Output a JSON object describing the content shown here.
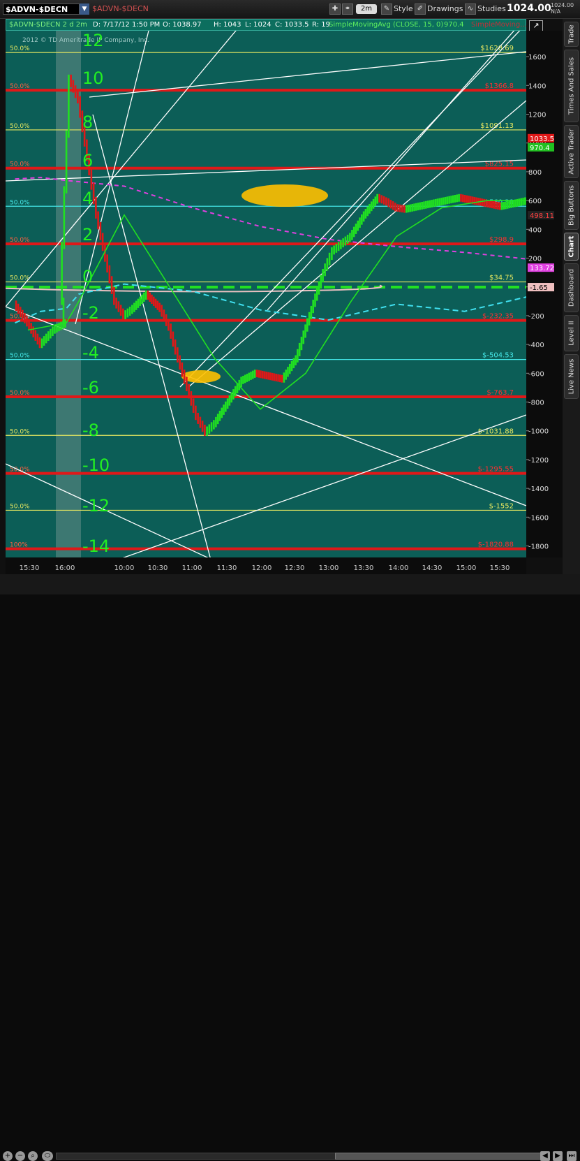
{
  "topbar": {
    "symbol": "$ADVN-$DECN",
    "symbol_echo": "$ADVN-$DECN",
    "aggregation": "2m",
    "style_label": "Style",
    "drawings_label": "Drawings",
    "studies_label": "Studies",
    "last_price": "1024.00",
    "small_info": [
      "1024.00",
      "N/A"
    ]
  },
  "infobar": {
    "symbol_period": "$ADVN-$DECN 2 d 2m",
    "date": "D: 7/17/12 1:50 PM",
    "open": "O: 1038.97",
    "high": "H: 1043",
    "low": "L: 1024",
    "close": "C: 1033.5",
    "range": "R: 19",
    "study": "SimpleMovingAvg (CLOSE, 15, 0)",
    "study_value": "970.4",
    "study2": "SimpleMoving..."
  },
  "copyright": "2012 © TD Ameritrade IP Company, Inc.",
  "side_tabs": [
    "Trade",
    "Times And Sales",
    "Active Trader",
    "Big Buttons",
    "Chart",
    "Dashboard",
    "Level II",
    "Live News"
  ],
  "active_tab": "Chart",
  "colors": {
    "background": "#0c5e57",
    "price_up": "#21e021",
    "price_down": "#e01818",
    "fib_red": "#e01818",
    "fib_cyan": "#44e6e6",
    "fib_yellow": "#e8e860",
    "sma_magenta": "#e040e0",
    "sma_cyan": "#40e0f0",
    "zero_green": "#22e022",
    "ellipse": "#ffc000"
  },
  "chart_data": {
    "type": "line",
    "title": "",
    "xlabel": "",
    "ylabel": "",
    "ylim": [
      -1880,
      1780
    ],
    "x_ticks": [
      "15:30",
      "16:00",
      "10:00",
      "10:30",
      "11:00",
      "11:30",
      "12:00",
      "12:30",
      "13:00",
      "13:30",
      "14:00",
      "14:30",
      "15:00",
      "15:30"
    ],
    "y_ticks": [
      1600,
      1400,
      1200,
      1000,
      800,
      600,
      400,
      200,
      0,
      -200,
      -400,
      -600,
      -800,
      -1000,
      -1200,
      -1400,
      -1600,
      -1800
    ],
    "fib_levels": [
      {
        "value": 1628.69,
        "label": "$1628.69",
        "color": "#e8e860",
        "pct": "50.0%"
      },
      {
        "value": 1366.8,
        "label": "$1366.8",
        "color": "#e01818",
        "pct": "50.0%"
      },
      {
        "value": 1091.13,
        "label": "$1091.13",
        "color": "#e8e860",
        "pct": "50.0%"
      },
      {
        "value": 825.15,
        "label": "$825.15",
        "color": "#e01818",
        "pct": "50.0%"
      },
      {
        "value": 560.38,
        "label": "$560.38",
        "color": "#44e6e6",
        "pct": "50.0%"
      },
      {
        "value": 298.9,
        "label": "$298.9",
        "color": "#e01818",
        "pct": "50.0%"
      },
      {
        "value": 34.75,
        "label": "$34.75",
        "color": "#e8e860",
        "pct": "50.0%"
      },
      {
        "value": -232.35,
        "label": "$-232.35",
        "color": "#e01818",
        "pct": "50.0%"
      },
      {
        "value": -504.53,
        "label": "$-504.53",
        "color": "#44e6e6",
        "pct": "50.0%"
      },
      {
        "value": -763.7,
        "label": "$-763.7",
        "color": "#e01818",
        "pct": "50.0%"
      },
      {
        "value": -1031.88,
        "label": "$-1031.88",
        "color": "#e8e860",
        "pct": "50.0%"
      },
      {
        "value": -1295.55,
        "label": "$-1295.55",
        "color": "#e01818",
        "pct": "50.0%"
      },
      {
        "value": -1552,
        "label": "$-1552",
        "color": "#e8e860",
        "pct": "50.0%"
      },
      {
        "value": -1820,
        "label": "$-1820.88",
        "color": "#e01818",
        "pct": "100%"
      }
    ],
    "markers": [
      {
        "value": 1033.5,
        "label": "1033.5",
        "bg": "#e01818",
        "fg": "#ffffff"
      },
      {
        "value": 970.4,
        "label": "970.4",
        "bg": "#21c021",
        "fg": "#ffffff"
      },
      {
        "value": 498.11,
        "label": "498.11",
        "bg": "#222222",
        "fg": "#ff4040"
      },
      {
        "value": 133.72,
        "label": "133.72",
        "bg": "#e040e0",
        "fg": "#ffffff"
      },
      {
        "value": -1.65,
        "label": "-1.65",
        "bg": "#f0c0c0",
        "fg": "#000000"
      }
    ],
    "secondary_scale": [
      "12",
      "10",
      "8",
      "6",
      "4",
      "2",
      "0",
      "-2",
      "-4",
      "-6",
      "-8",
      "-10",
      "-12",
      "-14"
    ],
    "series": [
      {
        "kind": "price",
        "x": [
          "15:20",
          "15:30",
          "15:40",
          "15:50",
          "16:00",
          "09:32",
          "09:36",
          "09:40",
          "09:44",
          "09:48",
          "09:52",
          "09:56",
          "10:00",
          "10:04",
          "10:10",
          "10:16",
          "10:20",
          "10:24",
          "10:28",
          "10:32",
          "10:36",
          "10:40",
          "10:46",
          "10:52",
          "10:58",
          "11:04",
          "11:10",
          "11:16",
          "11:22",
          "11:28",
          "11:32",
          "11:36",
          "11:40",
          "11:46",
          "11:52",
          "11:56",
          "12:00",
          "12:04",
          "12:10",
          "12:16",
          "12:22",
          "12:28",
          "12:34",
          "12:40",
          "12:46",
          "12:52",
          "12:58",
          "13:04",
          "13:10",
          "13:16",
          "13:22",
          "13:28",
          "13:34",
          "13:40",
          "13:46",
          "13:50"
        ],
        "values": [
          -120,
          -250,
          -400,
          -300,
          -250,
          -100,
          1450,
          1300,
          900,
          500,
          200,
          -100,
          -200,
          -150,
          -50,
          -150,
          -280,
          -500,
          -700,
          -900,
          -1010,
          -950,
          -800,
          -650,
          -600,
          -620,
          -640,
          -500,
          -200,
          100,
          250,
          300,
          350,
          500,
          620,
          590,
          550,
          540,
          560,
          580,
          600,
          620,
          600,
          580,
          560,
          580,
          600,
          640,
          700,
          800,
          900,
          960,
          980,
          1020,
          1030,
          1033.5
        ]
      },
      {
        "kind": "sma15",
        "color": "#21e021",
        "x": [
          "15:30",
          "16:00",
          "09:40",
          "10:00",
          "10:20",
          "10:40",
          "11:00",
          "11:20",
          "11:40",
          "12:00",
          "12:20",
          "12:40",
          "13:00",
          "13:20",
          "13:40",
          "13:50"
        ],
        "values": [
          -300,
          -250,
          -100,
          500,
          0,
          -500,
          -850,
          -600,
          -100,
          350,
          550,
          600,
          600,
          700,
          850,
          970
        ]
      },
      {
        "kind": "sma_magenta",
        "color": "#e040e0",
        "x": [
          "15:20",
          "15:40",
          "16:00",
          "10:00",
          "10:30",
          "11:00",
          "11:30",
          "12:00",
          "12:30",
          "13:00",
          "13:30",
          "13:50"
        ],
        "values": [
          750,
          760,
          740,
          700,
          550,
          420,
          330,
          280,
          240,
          190,
          150,
          133.72
        ]
      },
      {
        "kind": "sma_cyan",
        "color": "#40e0f0",
        "x": [
          "15:20",
          "15:40",
          "16:00",
          "09:40",
          "10:00",
          "10:30",
          "11:00",
          "11:30",
          "12:00",
          "12:30",
          "13:00",
          "13:30",
          "13:50"
        ],
        "values": [
          -250,
          -170,
          -150,
          -50,
          20,
          -30,
          -160,
          -230,
          -120,
          -170,
          -60,
          220,
          498.11
        ]
      },
      {
        "kind": "zero_line",
        "color": "#22e022",
        "values": [
          -1.65
        ]
      }
    ]
  }
}
